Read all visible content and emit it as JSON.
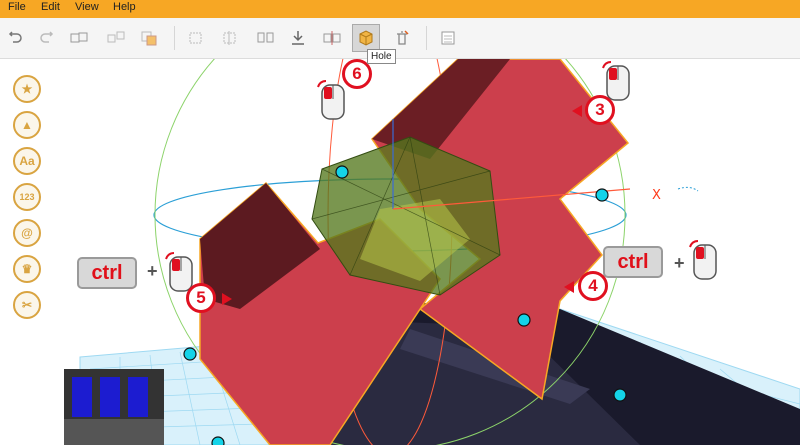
{
  "menu": [
    "File",
    "Edit",
    "View",
    "Help"
  ],
  "toolbar": {
    "tooltip": "Hole",
    "buttons": [
      "undo-icon",
      "redo-icon",
      "group-icon",
      "ungroup-icon",
      "duplicate-icon",
      "align-icon",
      "flip-icon",
      "mirror-icon",
      "download-icon",
      "cut-icon",
      "hole-icon",
      "delete-icon",
      "notes-icon"
    ]
  },
  "sidebar": {
    "buttons": [
      {
        "icon": "star-icon",
        "label": "★"
      },
      {
        "icon": "shapes-icon",
        "label": "▲"
      },
      {
        "icon": "text-icon",
        "label": "Aa"
      },
      {
        "icon": "numbers-icon",
        "label": "123"
      },
      {
        "icon": "symbols-icon",
        "label": "@"
      },
      {
        "icon": "crown-icon",
        "label": "♛"
      },
      {
        "icon": "tools-icon",
        "label": "✂"
      }
    ]
  },
  "annotations": {
    "ctrl_left": "ctrl",
    "ctrl_right": "ctrl",
    "plus": "+",
    "step3": "3",
    "step4": "4",
    "step5": "5",
    "step6": "6"
  },
  "colors": {
    "menubar": "#f7a724",
    "accent_red": "#e01020",
    "block_red": "#cc3f4c",
    "block_dark": "#6b1e24",
    "orbit_blue": "#2b9fd6",
    "handle_cyan": "#14d3e8",
    "grid_blue": "#9ed9f2"
  }
}
